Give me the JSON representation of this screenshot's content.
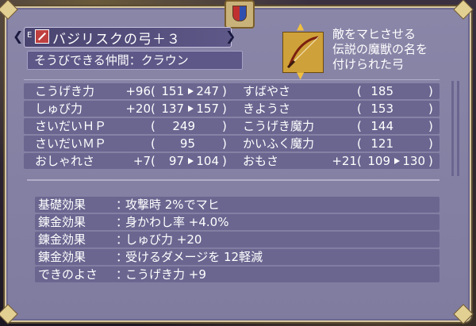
{
  "item": {
    "slot_badge": "E",
    "name": "バジリスクの弓＋３",
    "equippable_label": "そうびできる仲間：クラウン"
  },
  "description": [
    "敵をマヒさせる",
    "伝説の魔獣の名を",
    "付けられた弓"
  ],
  "stats": [
    {
      "name": "こうげき力",
      "delta": "+96",
      "from": "151",
      "to": "247"
    },
    {
      "name": "しゅび力",
      "delta": "+20",
      "from": "137",
      "to": "157"
    },
    {
      "name": "さいだいＨＰ",
      "delta": "",
      "from": "249",
      "to": ""
    },
    {
      "name": "さいだいＭＰ",
      "delta": "",
      "from": "95",
      "to": ""
    },
    {
      "name": "おしゃれさ",
      "delta": "+7",
      "from": "97",
      "to": "104"
    },
    {
      "name": "すばやさ",
      "delta": "",
      "from": "185",
      "to": ""
    },
    {
      "name": "きようさ",
      "delta": "",
      "from": "153",
      "to": ""
    },
    {
      "name": "こうげき魔力",
      "delta": "",
      "from": "144",
      "to": ""
    },
    {
      "name": "かいふく魔力",
      "delta": "",
      "from": "121",
      "to": ""
    },
    {
      "name": "おもさ",
      "delta": "+21",
      "from": "109",
      "to": "130"
    }
  ],
  "effects": [
    {
      "label": "基礎効果",
      "value": "攻撃時 2%でマヒ"
    },
    {
      "label": "錬金効果",
      "value": "身かわし率 +4.0%"
    },
    {
      "label": "錬金効果",
      "value": "しゅび力 +20"
    },
    {
      "label": "錬金効果",
      "value": "受けるダメージを 12軽減"
    },
    {
      "label": "できのよさ",
      "value": "こうげき力 +9"
    }
  ],
  "colors": {
    "panel": "#8a86a8",
    "row": "#6a6690",
    "gold": "#d7c7a0"
  },
  "icons": [
    "crest-icon",
    "bow-icon",
    "equipped-badge-icon",
    "arrow-left-icon",
    "arrow-right-icon",
    "scroll-up-icon",
    "scroll-down-icon"
  ]
}
